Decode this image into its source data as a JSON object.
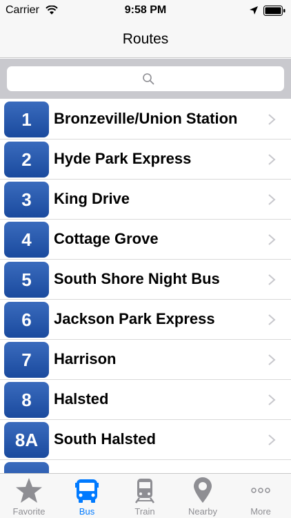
{
  "status_bar": {
    "carrier": "Carrier",
    "time": "9:58 PM"
  },
  "nav": {
    "title": "Routes"
  },
  "search": {
    "placeholder": ""
  },
  "routes": [
    {
      "number": "1",
      "name": "Bronzeville/Union Station"
    },
    {
      "number": "2",
      "name": "Hyde Park Express"
    },
    {
      "number": "3",
      "name": "King Drive"
    },
    {
      "number": "4",
      "name": "Cottage Grove"
    },
    {
      "number": "5",
      "name": "South Shore Night Bus"
    },
    {
      "number": "6",
      "name": "Jackson Park Express"
    },
    {
      "number": "7",
      "name": "Harrison"
    },
    {
      "number": "8",
      "name": "Halsted"
    },
    {
      "number": "8A",
      "name": "South Halsted"
    }
  ],
  "tabs": [
    {
      "label": "Favorite",
      "icon": "star-icon"
    },
    {
      "label": "Bus",
      "icon": "bus-icon",
      "active": true
    },
    {
      "label": "Train",
      "icon": "train-icon"
    },
    {
      "label": "Nearby",
      "icon": "map-pin-icon"
    },
    {
      "label": "More",
      "icon": "more-dots-icon"
    }
  ],
  "colors": {
    "badge": "#2456a8",
    "active_tab": "#007aff",
    "inactive_tab": "#8e8e93"
  }
}
